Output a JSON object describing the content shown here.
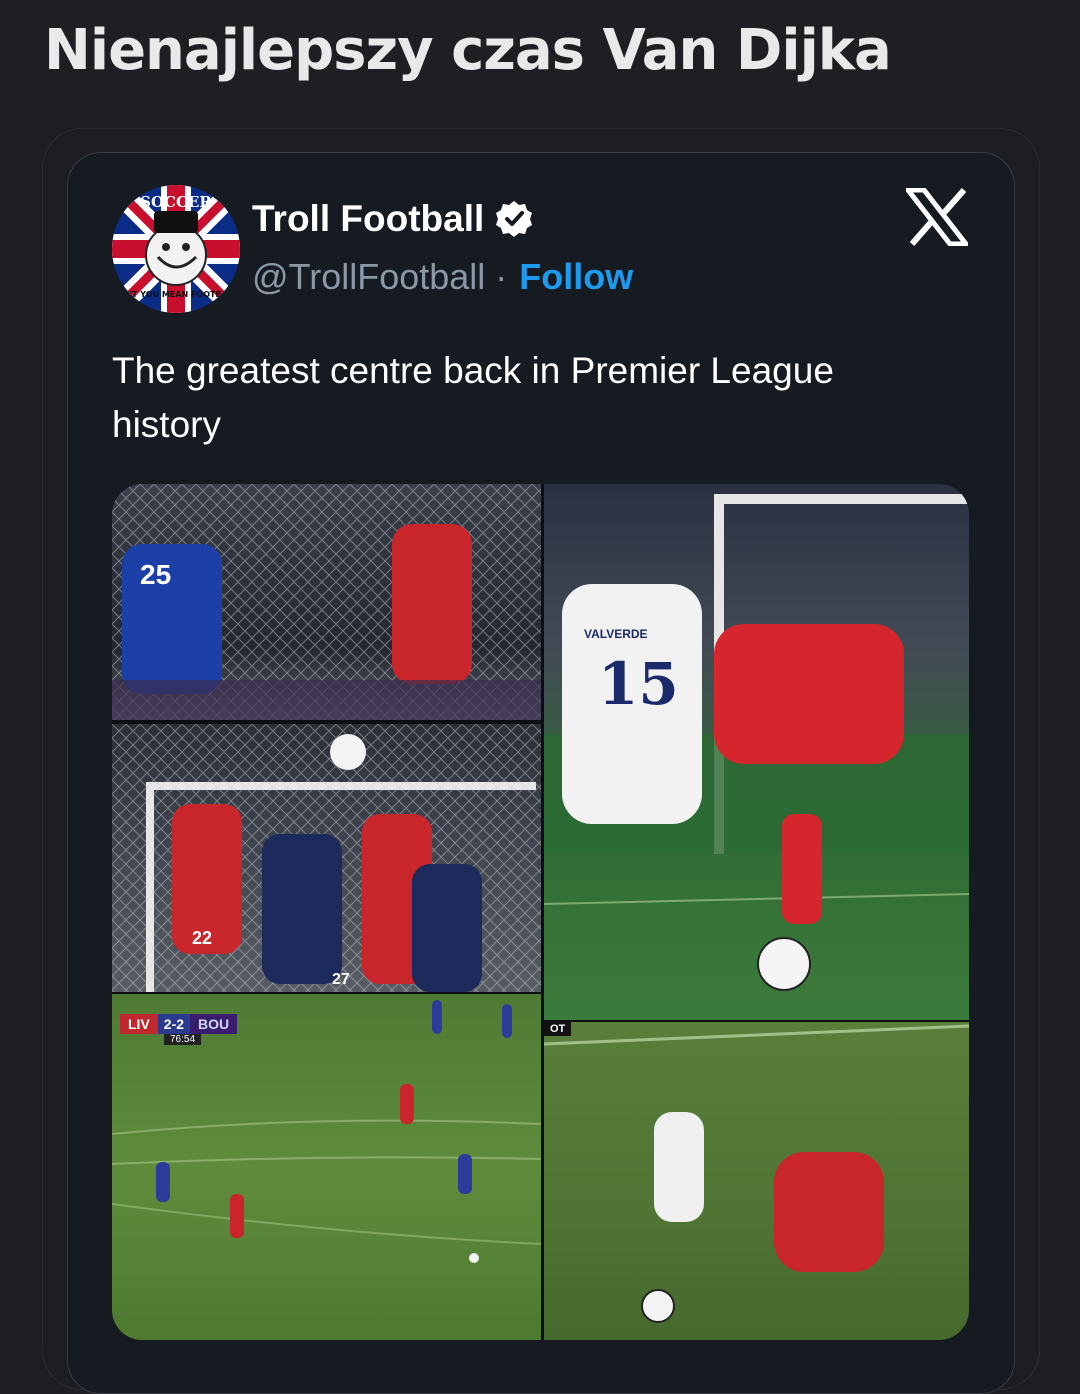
{
  "page": {
    "title": "Nienajlepszy czas Van Dijka"
  },
  "tweet": {
    "author_name": "Troll Football",
    "handle": "@TrollFootball",
    "separator": "·",
    "follow_label": "Follow",
    "text": "The greatest centre back in Premier League history",
    "avatar_text_top": "SOCCER",
    "avatar_text_bottom": "DON'T YOU MEAN FOOTBALL?"
  },
  "media": {
    "scoreboard": {
      "home": "LIV",
      "score": "2-2",
      "away": "BOU",
      "clock": "76:54"
    },
    "shirt_numbers": [
      "25",
      "15",
      "22",
      "27"
    ],
    "shirt_name": "VALVERDE",
    "ot_badge": "OT"
  },
  "colors": {
    "background": "#1e1f23",
    "card": "#161b22",
    "link": "#1d9bf0",
    "muted": "#8b98a5"
  },
  "icons": [
    "verified-badge-icon",
    "x-logo-icon"
  ]
}
